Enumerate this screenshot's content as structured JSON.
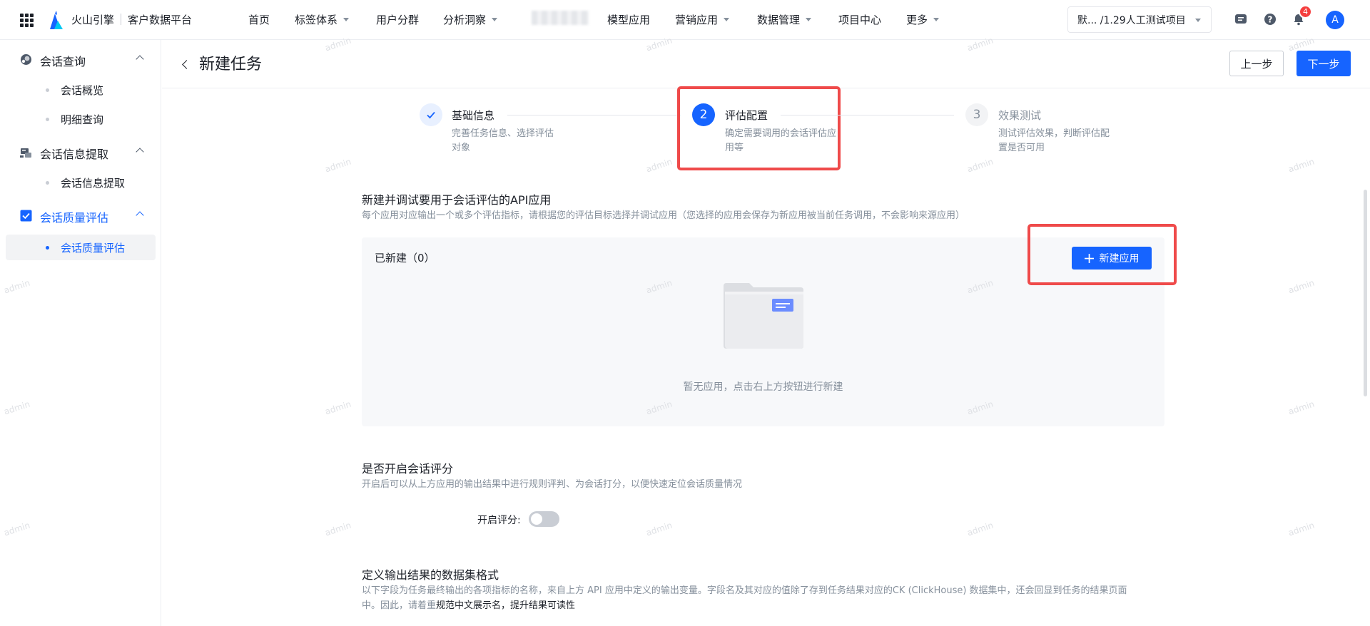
{
  "topbar": {
    "brand": "火山引擎",
    "product": "客户数据平台",
    "nav": [
      {
        "label": "首页",
        "dropdown": false
      },
      {
        "label": "标签体系",
        "dropdown": true
      },
      {
        "label": "用户分群",
        "dropdown": false
      },
      {
        "label": "分析洞察",
        "dropdown": true
      },
      {
        "label": "模型应用",
        "dropdown": false
      },
      {
        "label": "营销应用",
        "dropdown": true
      },
      {
        "label": "数据管理",
        "dropdown": true
      },
      {
        "label": "项目中心",
        "dropdown": false
      },
      {
        "label": "更多",
        "dropdown": true
      }
    ],
    "project_selector": "默... /1.29人工测试项目",
    "notification_count": "4",
    "avatar_letter": "A",
    "icons": [
      "apps-grid-icon",
      "volcano-logo-icon",
      "message-icon",
      "help-icon",
      "bell-icon"
    ]
  },
  "sidebar": {
    "groups": [
      {
        "label": "会话查询",
        "icon": "chat-search-icon",
        "active": false,
        "items": [
          {
            "label": "会话概览",
            "active": false
          },
          {
            "label": "明细查询",
            "active": false
          }
        ]
      },
      {
        "label": "会话信息提取",
        "icon": "extract-icon",
        "active": false,
        "items": [
          {
            "label": "会话信息提取",
            "active": false
          }
        ]
      },
      {
        "label": "会话质量评估",
        "icon": "checkbox-icon",
        "active": true,
        "items": [
          {
            "label": "会话质量评估",
            "active": true
          }
        ]
      }
    ]
  },
  "page": {
    "title": "新建任务",
    "prev_label": "上一步",
    "next_label": "下一步"
  },
  "steps": [
    {
      "number": "1",
      "title": "基础信息",
      "desc": "完善任务信息、选择评估对象",
      "status": "done"
    },
    {
      "number": "2",
      "title": "评估配置",
      "desc": "确定需要调用的会话评估应用等",
      "status": "current"
    },
    {
      "number": "3",
      "title": "效果测试",
      "desc": "测试评估效果，判断评估配置是否可用",
      "status": "pending"
    }
  ],
  "api_section": {
    "title": "新建并调试要用于会话评估的API应用",
    "desc": "每个应用对应输出一个或多个评估指标，请根据您的评估目标选择并调试应用（您选择的应用会保存为新应用被当前任务调用，不会影响来源应用）",
    "created_label": "已新建（0）",
    "new_app_label": "新建应用",
    "empty_text": "暂无应用，点击右上方按钮进行新建"
  },
  "scoring_section": {
    "title": "是否开启会话评分",
    "desc": "开启后可以从上方应用的输出结果中进行规则评判、为会话打分，以便快速定位会话质量情况",
    "toggle_label": "开启评分:",
    "toggle_on": false
  },
  "format_section": {
    "title": "定义输出结果的数据集格式",
    "desc_line1": "以下字段为任务最终输出的各项指标的名称，来自上方 API 应用中定义的输出变量。字段名及其对应的值除了存到任务结果对应的CK (ClickHouse) 数据集中，还会回显到任务的结果页面",
    "desc_line2_prefix": "中。因此，请着重",
    "desc_line2_emphasis": "规范中文展示名，提升结果可读性"
  },
  "watermark": "admin",
  "colors": {
    "primary": "#1664ff",
    "highlight_box": "#ef4a4a",
    "badge": "#f53f3f"
  }
}
